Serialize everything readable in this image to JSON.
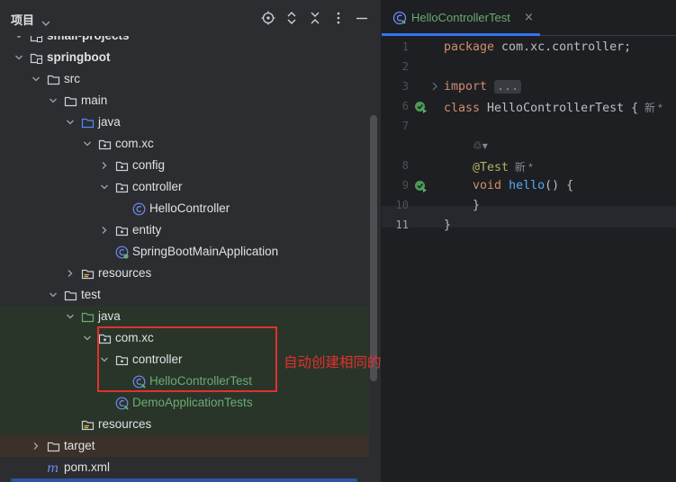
{
  "panel": {
    "title": "项目",
    "tools": [
      "locate-icon",
      "expand-all-icon",
      "collapse-all-icon",
      "more-icon",
      "minimize-icon"
    ]
  },
  "tree": [
    {
      "label": "small-projects",
      "icon": "module-folder",
      "depth": 1,
      "arrow": "down",
      "color": "#dfe1e5",
      "bold": true,
      "bg": ""
    },
    {
      "label": "springboot",
      "icon": "module-folder",
      "depth": 1,
      "arrow": "down",
      "color": "#dfe1e5",
      "bold": true,
      "bg": ""
    },
    {
      "label": "src",
      "icon": "folder",
      "depth": 2,
      "arrow": "down",
      "color": "#dfe1e5",
      "bold": false,
      "bg": ""
    },
    {
      "label": "main",
      "icon": "folder",
      "depth": 3,
      "arrow": "down",
      "color": "#dfe1e5",
      "bold": false,
      "bg": ""
    },
    {
      "label": "java",
      "icon": "source-folder",
      "depth": 4,
      "arrow": "down",
      "color": "#dfe1e5",
      "bold": false,
      "bg": ""
    },
    {
      "label": "com.xc",
      "icon": "package",
      "depth": 5,
      "arrow": "down",
      "color": "#dfe1e5",
      "bold": false,
      "bg": ""
    },
    {
      "label": "config",
      "icon": "package",
      "depth": 6,
      "arrow": "right",
      "color": "#dfe1e5",
      "bold": false,
      "bg": ""
    },
    {
      "label": "controller",
      "icon": "package",
      "depth": 6,
      "arrow": "down",
      "color": "#dfe1e5",
      "bold": false,
      "bg": ""
    },
    {
      "label": "HelloController",
      "icon": "class",
      "depth": 7,
      "arrow": "",
      "color": "#dfe1e5",
      "bold": false,
      "bg": ""
    },
    {
      "label": "entity",
      "icon": "package",
      "depth": 6,
      "arrow": "right",
      "color": "#dfe1e5",
      "bold": false,
      "bg": ""
    },
    {
      "label": "SpringBootMainApplication",
      "icon": "spring-class",
      "depth": 6,
      "arrow": "",
      "color": "#dfe1e5",
      "bold": false,
      "bg": ""
    },
    {
      "label": "resources",
      "icon": "resources-folder",
      "depth": 4,
      "arrow": "right",
      "color": "#dfe1e5",
      "bold": false,
      "bg": ""
    },
    {
      "label": "test",
      "icon": "folder",
      "depth": 3,
      "arrow": "down",
      "color": "#dfe1e5",
      "bold": false,
      "bg": ""
    },
    {
      "label": "java",
      "icon": "test-folder",
      "depth": 4,
      "arrow": "down",
      "color": "#dfe1e5",
      "bold": false,
      "bg": "green"
    },
    {
      "label": "com.xc",
      "icon": "package",
      "depth": 5,
      "arrow": "down",
      "color": "#dfe1e5",
      "bold": false,
      "bg": "green"
    },
    {
      "label": "controller",
      "icon": "package",
      "depth": 6,
      "arrow": "down",
      "color": "#dfe1e5",
      "bold": false,
      "bg": "green"
    },
    {
      "label": "HelloControllerTest",
      "icon": "test-class",
      "depth": 7,
      "arrow": "",
      "color": "#6aab73",
      "bold": false,
      "bg": "green"
    },
    {
      "label": "DemoApplicationTests",
      "icon": "test-class",
      "depth": 6,
      "arrow": "",
      "color": "#6aab73",
      "bold": false,
      "bg": "green"
    },
    {
      "label": "resources",
      "icon": "resources-folder",
      "depth": 4,
      "arrow": "",
      "color": "#dfe1e5",
      "bold": false,
      "bg": "green"
    },
    {
      "label": "target",
      "icon": "folder",
      "depth": 2,
      "arrow": "right",
      "color": "#dfe1e5",
      "bold": false,
      "bg": "brown"
    },
    {
      "label": "pom.xml",
      "icon": "maven-file",
      "depth": 2,
      "arrow": "",
      "color": "#dfe1e5",
      "bold": false,
      "bg": ""
    }
  ],
  "annotation": {
    "text": "自动创建相同的包结构",
    "color": "#e0312e"
  },
  "editor": {
    "tab_label": "HelloControllerTest",
    "tab_close": "×",
    "lines": [
      {
        "num": "1",
        "parts": [
          {
            "t": "package",
            "c": "kw"
          },
          {
            "t": " com.xc.controller;",
            "c": ""
          }
        ]
      },
      {
        "num": "2",
        "parts": []
      },
      {
        "num": "3",
        "parts": [
          {
            "t": "import",
            "c": "kw"
          },
          {
            "t": " ",
            "c": ""
          },
          {
            "t": "...",
            "c": "fold-box"
          }
        ]
      },
      {
        "num": "6",
        "parts": [
          {
            "t": "class",
            "c": "kw"
          },
          {
            "t": " HelloControllerTest {",
            "c": ""
          },
          {
            "t": "  新 *",
            "c": "hint"
          }
        ]
      },
      {
        "num": "7",
        "parts": []
      },
      {
        "num": "",
        "parts": [
          {
            "t": "    ",
            "c": ""
          },
          {
            "t": "♲▾",
            "c": "hint"
          }
        ]
      },
      {
        "num": "8",
        "parts": [
          {
            "t": "    ",
            "c": ""
          },
          {
            "t": "@Test",
            "c": "ann"
          },
          {
            "t": "  新 *",
            "c": "hint"
          }
        ]
      },
      {
        "num": "9",
        "parts": [
          {
            "t": "    ",
            "c": ""
          },
          {
            "t": "void",
            "c": "kw"
          },
          {
            "t": " ",
            "c": ""
          },
          {
            "t": "hello",
            "c": "fn"
          },
          {
            "t": "() {",
            "c": ""
          }
        ]
      },
      {
        "num": "10",
        "parts": [
          {
            "t": "    }",
            "c": ""
          }
        ]
      },
      {
        "num": "11",
        "parts": [
          {
            "t": "}",
            "c": ""
          }
        ]
      }
    ]
  },
  "colors": {
    "accent": "#3574f0",
    "test_green": "#6aab73",
    "keyword": "#cf8e6d"
  }
}
